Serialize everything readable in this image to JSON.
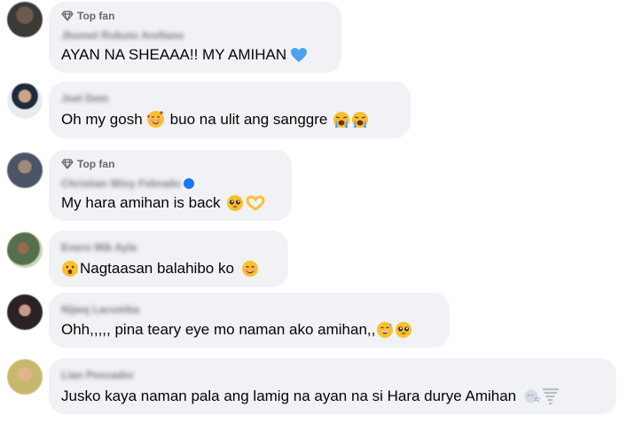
{
  "comments": [
    {
      "badge": "Top fan",
      "name": "Jhomel Robuto Arellano",
      "text": "AYAN NA SHEAAA!! MY AMIHAN",
      "emojis": [
        "blue-heart"
      ]
    },
    {
      "badge": "",
      "name": "Joel Dem",
      "text": "Oh my gosh",
      "emojis_inline": [
        "smiling-face-with-hearts"
      ],
      "text2": "buo na ulit ang sanggre",
      "emojis": [
        "loudly-crying-face",
        "loudly-crying-face"
      ]
    },
    {
      "badge": "Top fan",
      "name": "Christian Winy Febrado",
      "verified": true,
      "text": "My hara amihan is back",
      "emojis": [
        "pleading-face",
        "heart-hands"
      ]
    },
    {
      "badge": "",
      "name": "Enero Mik Ayla",
      "emoji_before": "face-with-open-mouth",
      "text": "Nagtaasan balahibo ko",
      "emojis": [
        "smiling-face"
      ]
    },
    {
      "badge": "",
      "name": "Nijwq Lacumba",
      "text": "Ohh,,,,, pina teary eye mo naman ako amihan,,",
      "emojis": [
        "grinning-sweat-face",
        "pleading-face"
      ]
    },
    {
      "badge": "",
      "name": "Lian Pescador",
      "text": "Jusko kaya naman pala ang lamig na ayan na si Hara durye Amihan",
      "emojis": [
        "wind-face",
        "tornado"
      ]
    }
  ],
  "colors": {
    "bubble": "#f0f2f5",
    "text": "#050505",
    "secondary": "#65676b",
    "verified": "#1877f2"
  }
}
